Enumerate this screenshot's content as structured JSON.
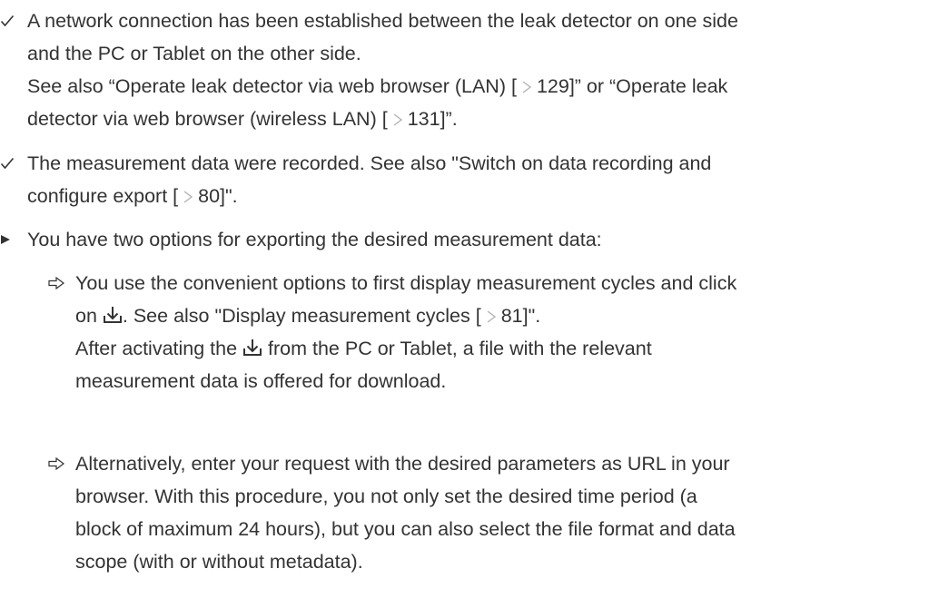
{
  "items": [
    {
      "marker": "checkmark-icon",
      "lines": [
        [
          "A network connection has been established between the leak detector on one side"
        ],
        [
          "and the PC or Tablet on the other side."
        ],
        [
          "See also “Operate leak detector via web browser (LAN) [",
          "129]” or “Operate leak"
        ],
        [
          "detector via web browser (wireless LAN) [",
          "131]”."
        ]
      ]
    },
    {
      "marker": "checkmark-icon",
      "lines": [
        [
          "The measurement data were recorded. See also \"Switch on data recording and"
        ],
        [
          "configure export [",
          "80]\"."
        ]
      ]
    },
    {
      "marker": "triangle-bullet-icon",
      "lines": [
        [
          "You have two options for exporting the desired measurement data:"
        ]
      ]
    },
    {
      "marker": "result-arrow-icon",
      "lines": [
        [
          "You use the convenient options to first display measurement cycles and click"
        ],
        [
          "on ",
          ". See also \"Display measurement cycles [",
          "81]\"."
        ],
        [
          "After activating the ",
          " from the PC or Tablet, a file with the relevant"
        ],
        [
          "measurement data is offered for download."
        ]
      ]
    },
    {
      "marker": "result-arrow-icon",
      "lines": [
        [
          "Alternatively, enter your request with the desired parameters as URL in your"
        ],
        [
          "browser. With this procedure, you not only set the desired time period (a"
        ],
        [
          "block of maximum 24 hours), but you can also select the file format and data"
        ],
        [
          "scope (with or without metadata)."
        ]
      ]
    }
  ],
  "colors": {
    "text": "#333333",
    "xref_arrow": "#b3b3b3"
  }
}
